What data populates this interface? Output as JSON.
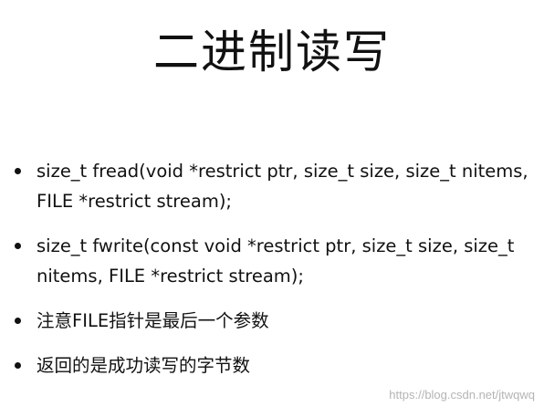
{
  "slide": {
    "title": "二进制读写",
    "bullets": [
      "size_t fread(void *restrict ptr, size_t size, size_t nitems, FILE *restrict stream);",
      "size_t fwrite(const void *restrict ptr, size_t size, size_t nitems, FILE *restrict stream);",
      "注意FILE指针是最后一个参数",
      "返回的是成功读写的字节数"
    ],
    "watermark": "https://blog.csdn.net/jtwqwq"
  }
}
